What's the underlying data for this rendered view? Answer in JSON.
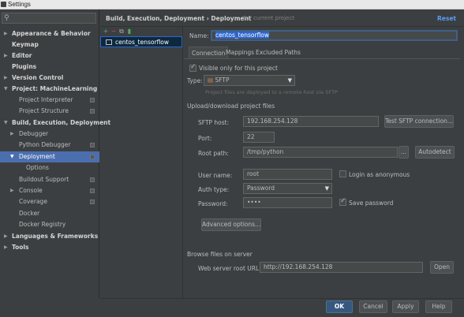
{
  "window": {
    "title": "Settings"
  },
  "search": {
    "placeholder": ""
  },
  "sidebar": {
    "items": [
      {
        "label": "Appearance & Behavior"
      },
      {
        "label": "Keymap"
      },
      {
        "label": "Editor"
      },
      {
        "label": "Plugins"
      },
      {
        "label": "Version Control"
      },
      {
        "label": "Project: MachineLearning"
      },
      {
        "label": "Project Interpreter"
      },
      {
        "label": "Project Structure"
      },
      {
        "label": "Build, Execution, Deployment"
      },
      {
        "label": "Debugger"
      },
      {
        "label": "Python Debugger"
      },
      {
        "label": "Deployment"
      },
      {
        "label": "Options"
      },
      {
        "label": "Buildout Support"
      },
      {
        "label": "Console"
      },
      {
        "label": "Coverage"
      },
      {
        "label": "Docker"
      },
      {
        "label": "Docker Registry"
      },
      {
        "label": "Languages & Frameworks"
      },
      {
        "label": "Tools"
      }
    ]
  },
  "header": {
    "breadcrumb": "Build, Execution, Deployment › Deployment",
    "note": "For current project",
    "reset": "Reset"
  },
  "servers": {
    "items": [
      {
        "label": "centos_tensorflow"
      }
    ]
  },
  "form": {
    "name_label": "Name:",
    "name_value": "centos_tensorflow",
    "tabs": [
      "Connection",
      "Mappings",
      "Excluded Paths"
    ],
    "visible_only": "Visible only for this project",
    "type_label": "Type:",
    "type_value": "SFTP",
    "type_hint": "Project files are deployed to a remote host via SFTP",
    "upload_section": "Upload/download project files",
    "host_label": "SFTP host:",
    "host_value": "192.168.254.128",
    "test_button": "Test SFTP connection...",
    "port_label": "Port:",
    "port_value": "22",
    "root_label": "Root path:",
    "root_value": "/tmp/python",
    "autodetect_button": "Autodetect",
    "user_label": "User name:",
    "user_value": "root",
    "anon_label": "Login as anonymous",
    "auth_label": "Auth type:",
    "auth_value": "Password",
    "pass_label": "Password:",
    "pass_value": "••••",
    "save_pass_label": "Save password",
    "advanced_button": "Advanced options...",
    "browse_section": "Browse files on server",
    "web_label": "Web server root URL:",
    "web_value": "http://192.168.254.128",
    "open_button": "Open"
  },
  "footer": {
    "ok": "OK",
    "cancel": "Cancel",
    "apply": "Apply",
    "help": "Help"
  }
}
